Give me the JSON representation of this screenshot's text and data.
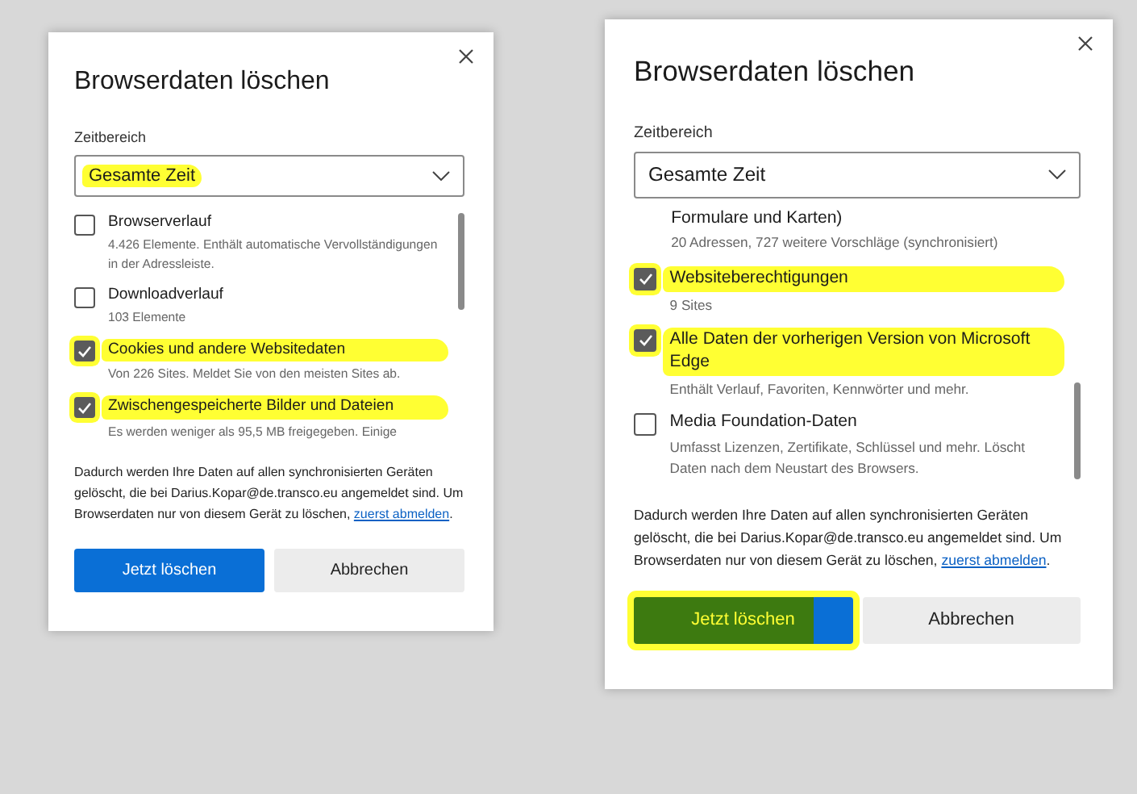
{
  "dialogs": [
    {
      "title": "Browserdaten löschen",
      "time_range": {
        "label": "Zeitbereich",
        "value": "Gesamte Zeit",
        "highlighted": true
      },
      "options": [
        {
          "kind": "checkbox",
          "label": "Browserverlauf",
          "description": "4.426 Elemente. Enthält automatische Vervollständigungen in der Adressleiste.",
          "checked": false,
          "highlighted": false
        },
        {
          "kind": "checkbox",
          "label": "Downloadverlauf",
          "description": "103 Elemente",
          "checked": false,
          "highlighted": false
        },
        {
          "kind": "checkbox",
          "label": "Cookies und andere Websitedaten",
          "description": "Von 226 Sites. Meldet Sie von den meisten Sites ab.",
          "checked": true,
          "highlighted": true
        },
        {
          "kind": "checkbox",
          "label": "Zwischengespeicherte Bilder und Dateien",
          "description": "Es werden weniger als 95,5 MB freigegeben. Einige",
          "checked": true,
          "highlighted": true
        }
      ],
      "notice": "Dadurch werden Ihre Daten auf allen synchronisierten Geräten gelöscht, die bei Darius.Kopar@de.transco.eu angemeldet sind. Um Browserdaten nur von diesem Gerät zu löschen,",
      "notice_link": "zuerst abmelden",
      "notice_end": ".",
      "buttons": [
        {
          "kind": "primary",
          "label": "Jetzt löschen",
          "highlighted": false
        },
        {
          "kind": "secondary",
          "label": "Abbrechen",
          "highlighted": false
        }
      ]
    },
    {
      "title": "Browserdaten löschen",
      "time_range": {
        "label": "Zeitbereich",
        "value": "Gesamte Zeit",
        "highlighted": false
      },
      "options": [
        {
          "kind": "continuation",
          "label": "Formulare und Karten)",
          "description": "20 Adressen, 727 weitere Vorschläge (synchronisiert)"
        },
        {
          "kind": "checkbox",
          "label": "Websiteberechtigungen",
          "description": "9 Sites",
          "checked": true,
          "highlighted": true
        },
        {
          "kind": "checkbox",
          "label": "Alle Daten der vorherigen Version von Microsoft Edge",
          "description": "Enthält Verlauf, Favoriten, Kennwörter und mehr.",
          "checked": true,
          "highlighted": true
        },
        {
          "kind": "checkbox",
          "label": "Media Foundation-Daten",
          "description": "Umfasst Lizenzen, Zertifikate, Schlüssel und mehr. Löscht Daten nach dem Neustart des Browsers.",
          "checked": false,
          "highlighted": false
        }
      ],
      "notice": "Dadurch werden Ihre Daten auf allen synchronisierten Geräten gelöscht, die bei Darius.Kopar@de.transco.eu angemeldet sind. Um Browserdaten nur von diesem Gerät zu löschen,",
      "notice_link": "zuerst abmelden",
      "notice_end": ".",
      "buttons": [
        {
          "kind": "primary",
          "label": "Jetzt löschen",
          "highlighted": true
        },
        {
          "kind": "secondary",
          "label": "Abbrechen",
          "highlighted": false
        }
      ]
    }
  ]
}
